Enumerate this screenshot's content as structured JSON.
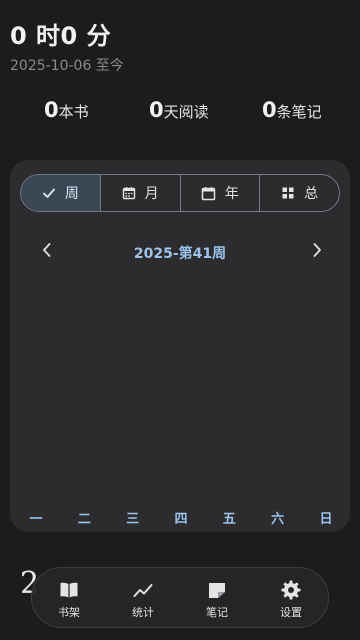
{
  "header": {
    "reading_time": "0 时0 分",
    "since": "2025-10-06 至今"
  },
  "stats": [
    {
      "value": "0",
      "label": "本书"
    },
    {
      "value": "0",
      "label": "天阅读"
    },
    {
      "value": "0",
      "label": "条笔记"
    }
  ],
  "range_tabs": [
    {
      "label": "周",
      "icon": "check-icon",
      "selected": true
    },
    {
      "label": "月",
      "icon": "calendar-month-icon",
      "selected": false
    },
    {
      "label": "年",
      "icon": "calendar-icon",
      "selected": false
    },
    {
      "label": "总",
      "icon": "grid-icon",
      "selected": false
    }
  ],
  "period": {
    "title": "2025-第41周",
    "prev_icon": "chevron-left-icon",
    "next_icon": "chevron-right-icon"
  },
  "weekdays": [
    "一",
    "二",
    "三",
    "四",
    "五",
    "六",
    "日"
  ],
  "behind_content": {
    "digit": "2"
  },
  "bottom_nav": [
    {
      "label": "书架",
      "icon": "book-icon"
    },
    {
      "label": "统计",
      "icon": "trend-icon"
    },
    {
      "label": "笔记",
      "icon": "note-icon"
    },
    {
      "label": "设置",
      "icon": "gear-icon"
    }
  ],
  "colors": {
    "background": "#1c1c1e",
    "card": "#2c2c2e",
    "accent": "#9ec3ec",
    "selected_segment": "#3c4756"
  }
}
